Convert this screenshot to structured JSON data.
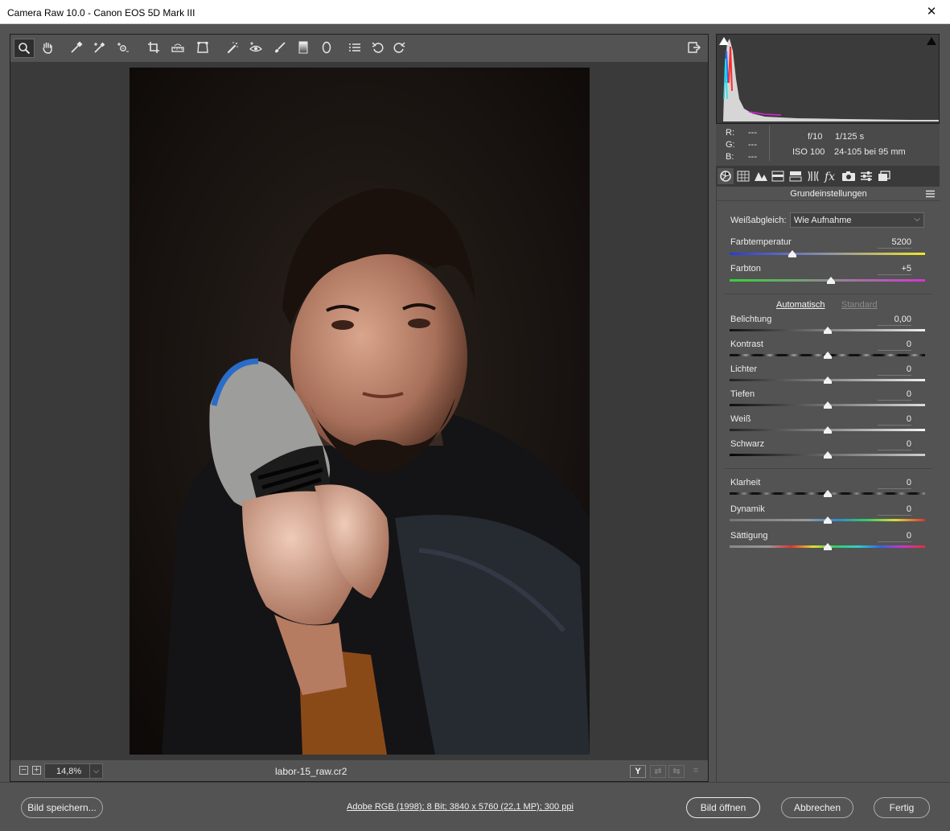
{
  "window": {
    "title": "Camera Raw 10.0 - Canon EOS 5D Mark III",
    "close_glyph": "✕"
  },
  "toolbar": {
    "tools": [
      "zoom-tool",
      "hand-tool",
      "white-balance-tool",
      "color-sampler-tool",
      "targeted-adjustment-tool",
      "crop-tool",
      "straighten-tool",
      "transform-tool",
      "spot-removal-tool",
      "red-eye-tool",
      "adjustment-brush-tool",
      "graduated-filter-tool",
      "radial-filter-tool",
      "preferences-tool",
      "rotate-ccw-tool",
      "rotate-cw-tool"
    ],
    "active": "zoom-tool"
  },
  "statusbar": {
    "zoom_minus": "−",
    "zoom_plus": "+",
    "zoom_value": "14,8%",
    "zoom_dropdown": "⌵",
    "filename": "labor-15_raw.cr2",
    "view_buttons": [
      "Y",
      "⇄",
      "⇆",
      "≡"
    ]
  },
  "readout": {
    "r_label": "R:",
    "r_value": "---",
    "g_label": "G:",
    "g_value": "---",
    "b_label": "B:",
    "b_value": "---",
    "aperture": "f/10",
    "shutter": "1/125 s",
    "iso": "ISO 100",
    "lens": "24-105 bei 95 mm"
  },
  "panel": {
    "tabs": [
      "basic-tab",
      "tone-curve-tab",
      "detail-tab",
      "hsl-tab",
      "split-toning-tab",
      "lens-tab",
      "effects-tab",
      "camera-calibration-tab",
      "presets-tab",
      "snapshots-tab"
    ],
    "title": "Grundeinstellungen",
    "wb_label": "Weißabgleich:",
    "wb_value": "Wie Aufnahme",
    "wb_caret": "⌵",
    "auto_label": "Automatisch",
    "default_label": "Standard",
    "sliders": [
      {
        "label": "Farbtemperatur",
        "value": "5200",
        "pos": 0.32
      },
      {
        "label": "Farbton",
        "value": "+5",
        "pos": 0.52
      },
      {
        "label": "Belichtung",
        "value": "0,00",
        "pos": 0.5
      },
      {
        "label": "Kontrast",
        "value": "0",
        "pos": 0.5
      },
      {
        "label": "Lichter",
        "value": "0",
        "pos": 0.5
      },
      {
        "label": "Tiefen",
        "value": "0",
        "pos": 0.5
      },
      {
        "label": "Weiß",
        "value": "0",
        "pos": 0.5
      },
      {
        "label": "Schwarz",
        "value": "0",
        "pos": 0.5
      },
      {
        "label": "Klarheit",
        "value": "0",
        "pos": 0.5
      },
      {
        "label": "Dynamik",
        "value": "0",
        "pos": 0.5
      },
      {
        "label": "Sättigung",
        "value": "0",
        "pos": 0.5
      }
    ]
  },
  "bottom": {
    "save": "Bild speichern...",
    "info": "Adobe RGB (1998); 8 Bit; 3840 x 5760 (22,1 MP); 300 ppi",
    "open": "Bild öffnen",
    "cancel": "Abbrechen",
    "done": "Fertig"
  }
}
